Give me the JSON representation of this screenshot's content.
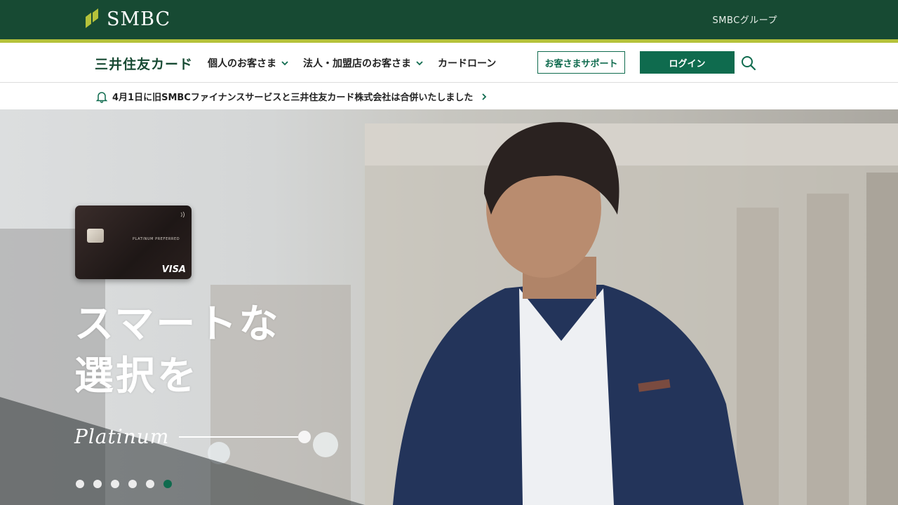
{
  "topbar": {
    "brand": "SMBC",
    "group_link": "SMBCグループ"
  },
  "nav": {
    "brand": "三井住友カード",
    "items": [
      {
        "label": "個人のお客さま",
        "has_dropdown": true
      },
      {
        "label": "法人・加盟店のお客さま",
        "has_dropdown": true
      },
      {
        "label": "カードローン",
        "has_dropdown": false
      }
    ],
    "support_label": "お客さまサポート",
    "login_label": "ログイン"
  },
  "notice": {
    "text": "4月1日に旧SMBCファイナンスサービスと三井住友カード株式会社は合併いたしました"
  },
  "hero": {
    "card": {
      "label": "PLATINUM PREFERRED",
      "network": "VISA"
    },
    "headline_line1": "スマートな",
    "headline_line2": "選択を",
    "script_text": "Platinum",
    "carousel": {
      "count": 6,
      "active_index": 5
    }
  },
  "colors": {
    "primary": "#174a33",
    "accent": "#0f6b4e",
    "stripe": "#b5c23a"
  }
}
